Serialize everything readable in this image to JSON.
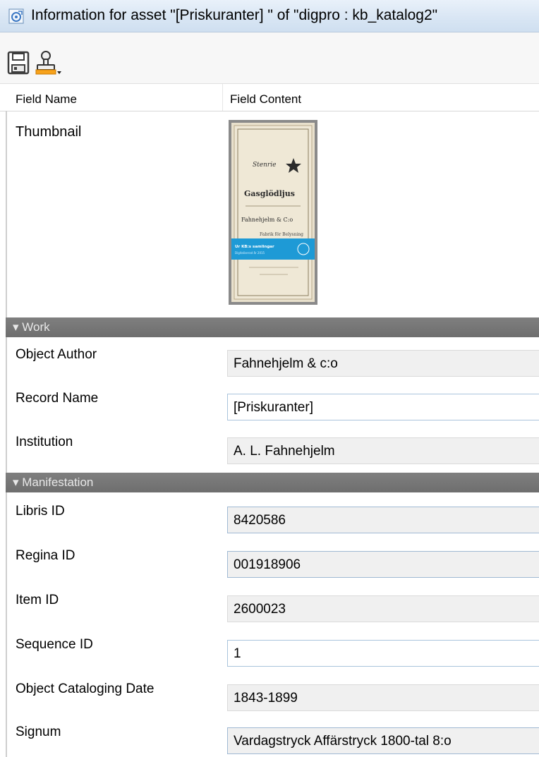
{
  "window": {
    "title": "Information for asset \"[Priskuranter]  \" of \"digpro : kb_katalog2\""
  },
  "toolbar": {
    "save_icon": "save-disk-icon",
    "stamp_icon": "stamp-dropdown-icon"
  },
  "columns": {
    "field_name": "Field Name",
    "field_content": "Field Content"
  },
  "thumbnail": {
    "label": "Thumbnail",
    "image_text": {
      "line1": "Gasglödljus",
      "line2": "Fahnehjelm & C:o",
      "banner": "Ur KB:s samlingar",
      "banner_sub": "Digitaliserad år 2015"
    }
  },
  "sections": {
    "work": "▾ Work",
    "manifestation": "▾ Manifestation"
  },
  "work": [
    {
      "label": "Object Author",
      "value": "Fahnehjelm & c:o"
    },
    {
      "label": "Record Name",
      "value": "[Priskuranter]"
    },
    {
      "label": "Institution",
      "value": "A. L. Fahnehjelm"
    }
  ],
  "manifestation": [
    {
      "label": "Libris ID",
      "value": "8420586"
    },
    {
      "label": "Regina ID",
      "value": "001918906"
    },
    {
      "label": "Item ID",
      "value": "2600023"
    },
    {
      "label": "Sequence ID",
      "value": "1"
    },
    {
      "label": "Object Cataloging Date",
      "value": "1843-1899"
    },
    {
      "label": "Signum",
      "value": "Vardagstryck Affärstryck 1800-tal 8:o"
    }
  ],
  "colors": {
    "section_bg": "#737373",
    "titlebar_bg": "#dce8f5",
    "thumbnail_banner": "#1e9ad6"
  }
}
